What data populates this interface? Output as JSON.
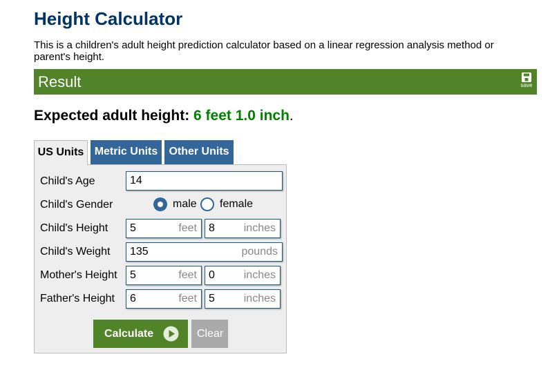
{
  "title": "Height Calculator",
  "intro": "This is a children's adult height prediction calculator based on a linear regression analysis method or parent's height.",
  "result": {
    "bar_title": "Result",
    "save_label": "save",
    "expected_label": "Expected adult height:",
    "expected_value": "6 feet 1.0 inch",
    "period": "."
  },
  "tabs": [
    {
      "label": "US Units",
      "active": true
    },
    {
      "label": "Metric Units",
      "active": false
    },
    {
      "label": "Other Units",
      "active": false
    }
  ],
  "form": {
    "age": {
      "label": "Child's Age",
      "value": "14"
    },
    "gender": {
      "label": "Child's Gender",
      "options": [
        "male",
        "female"
      ],
      "selected": "male"
    },
    "child_height": {
      "label": "Child's Height",
      "feet": "5",
      "inches": "8"
    },
    "child_weight": {
      "label": "Child's Weight",
      "value": "135",
      "unit": "pounds"
    },
    "mother_height": {
      "label": "Mother's Height",
      "feet": "5",
      "inches": "0"
    },
    "father_height": {
      "label": "Father's Height",
      "feet": "6",
      "inches": "5"
    },
    "unit_feet": "feet",
    "unit_inches": "inches"
  },
  "buttons": {
    "calculate": "Calculate",
    "clear": "Clear"
  },
  "colors": {
    "title": "#003366",
    "result_bar": "#518428",
    "result_value": "#008000",
    "tab_inactive": "#336699",
    "clear_button": "#aaaaaa"
  }
}
